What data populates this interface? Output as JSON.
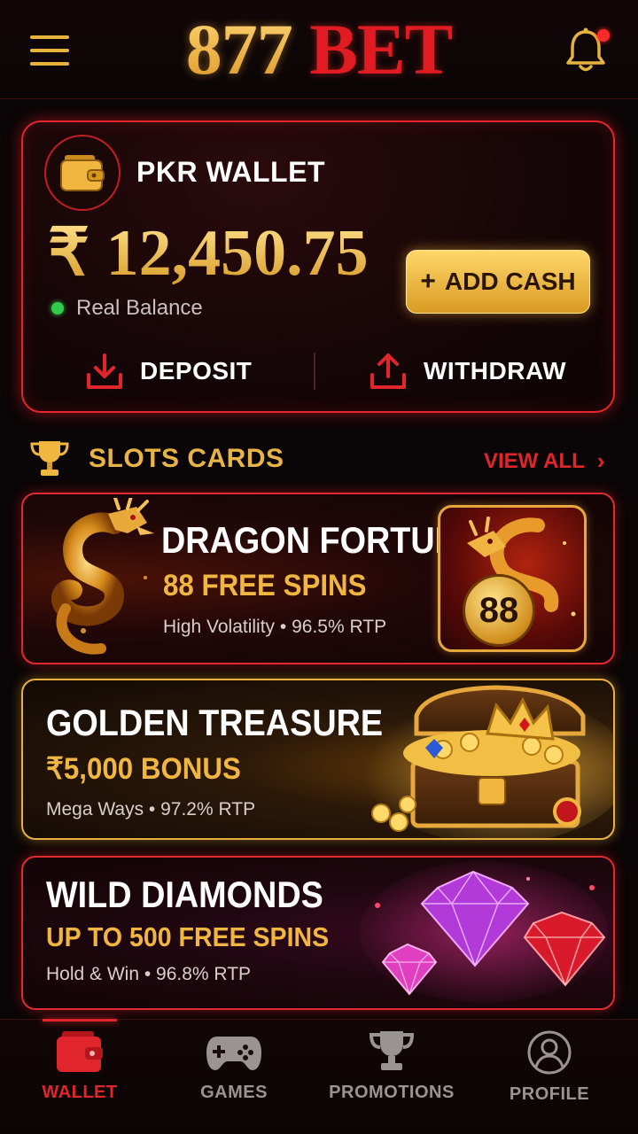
{
  "header": {
    "logo_number": "877",
    "logo_word": "BET",
    "menu_icon": "hamburger-menu-icon",
    "notification_icon": "bell-icon",
    "has_notification": true
  },
  "wallet": {
    "icon": "wallet-icon",
    "title": "PKR WALLET",
    "balance": "₹ 12,450.75",
    "balance_label": "Real Balance",
    "status_color": "#2ecc4a",
    "add_cash_label": "ADD CASH",
    "deposit_label": "DEPOSIT",
    "withdraw_label": "WITHDRAW"
  },
  "section": {
    "icon": "trophy-icon",
    "title": "SLOTS CARDS",
    "view_all_label": "VIEW ALL"
  },
  "slots": [
    {
      "title": "DRAGON FORTUNE",
      "offer": "88 FREE SPINS",
      "meta": "High Volatility • 96.5% RTP",
      "badge": "88",
      "art": "golden-dragon"
    },
    {
      "title": "GOLDEN TREASURE",
      "offer": "₹5,000 BONUS",
      "meta": "Mega Ways • 97.2% RTP",
      "art": "treasure-chest-with-crown"
    },
    {
      "title": "WILD DIAMONDS",
      "offer": "UP TO 500 FREE SPINS",
      "meta": "Hold & Win • 96.8% RTP",
      "art": "diamonds"
    }
  ],
  "nav": {
    "items": [
      {
        "label": "WALLET",
        "icon": "wallet-icon",
        "active": true
      },
      {
        "label": "GAMES",
        "icon": "gamepad-icon",
        "active": false
      },
      {
        "label": "PROMOTIONS",
        "icon": "trophy-icon",
        "active": false
      },
      {
        "label": "PROFILE",
        "icon": "user-icon",
        "active": false
      }
    ]
  },
  "colors": {
    "accent_red": "#e0262c",
    "accent_gold": "#f0b640",
    "background": "#0a0506"
  }
}
